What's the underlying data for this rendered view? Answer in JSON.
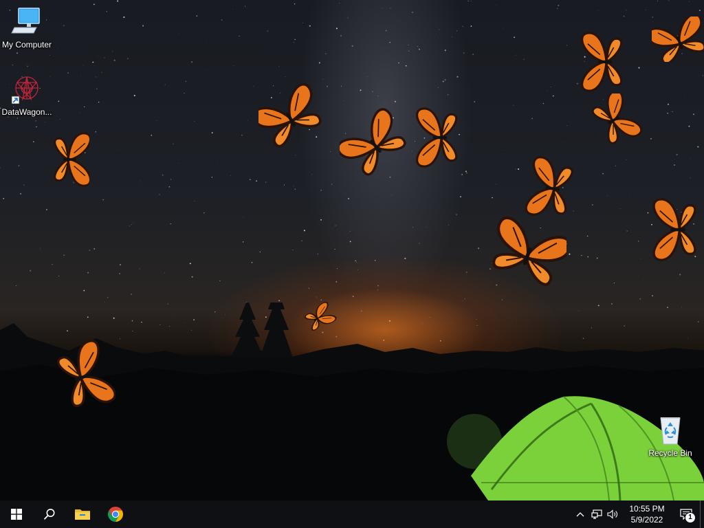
{
  "desktop": {
    "icons": [
      {
        "label": "My Computer",
        "icon": "computer-icon"
      },
      {
        "label": "DataWagon...",
        "icon": "datawagon-shortcut-icon"
      },
      {
        "label": "Recycle Bin",
        "icon": "recycle-bin-icon"
      }
    ],
    "wallpaper": "night-sky-camping-butterflies",
    "butterfly_color": "#e8741c"
  },
  "taskbar": {
    "start": "windows-start-icon",
    "search": "search-icon",
    "pinned": [
      {
        "name": "file-explorer",
        "icon": "folder-icon"
      },
      {
        "name": "google-chrome",
        "icon": "chrome-icon"
      }
    ],
    "tray": {
      "icons": [
        "chevron-up-icon",
        "network-icon",
        "volume-icon"
      ],
      "time": "10:55 PM",
      "date": "5/9/2022",
      "notification_count": "1"
    }
  }
}
